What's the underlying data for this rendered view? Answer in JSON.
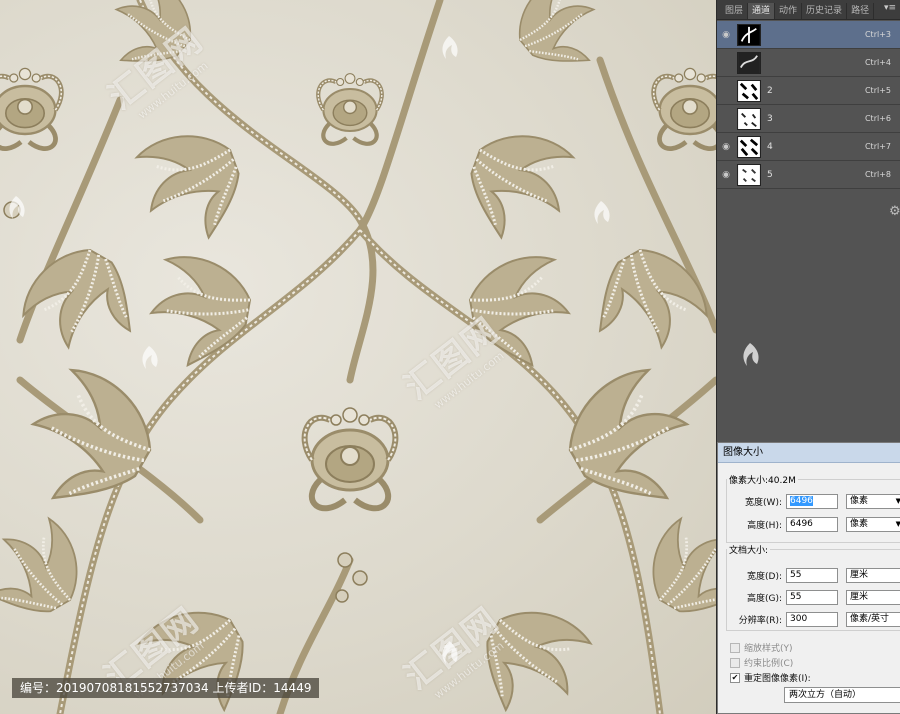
{
  "caption": "编号：20190708181552737034 上传者ID：14449",
  "watermark": {
    "text": "汇图网",
    "sub": "www.huitu.com"
  },
  "panel": {
    "tabs": [
      {
        "label": "图层",
        "active": false
      },
      {
        "label": "通道",
        "active": true
      },
      {
        "label": "动作",
        "active": false
      },
      {
        "label": "历史记录",
        "active": false
      },
      {
        "label": "路径",
        "active": false
      }
    ],
    "menu_icon": "panel-menu-icon",
    "channels": [
      {
        "name": "",
        "shortcut": "Ctrl+3",
        "selected": true
      },
      {
        "name": "",
        "shortcut": "Ctrl+4",
        "selected": false
      },
      {
        "name": "2",
        "shortcut": "Ctrl+5",
        "selected": false
      },
      {
        "name": "3",
        "shortcut": "Ctrl+6",
        "selected": false
      },
      {
        "name": "4",
        "shortcut": "Ctrl+7",
        "selected": false
      },
      {
        "name": "5",
        "shortcut": "Ctrl+8",
        "selected": false
      }
    ]
  },
  "dialog": {
    "title": "图像大小",
    "pixel_group": "像素大小:40.2M",
    "pixel_width_label": "宽度(W):",
    "pixel_width": "6496",
    "pixel_width_unit": "像素",
    "pixel_height_label": "高度(H):",
    "pixel_height": "6496",
    "pixel_height_unit": "像素",
    "doc_group": "文档大小:",
    "doc_width_label": "宽度(D):",
    "doc_width": "55",
    "doc_width_unit": "厘米",
    "doc_height_label": "高度(G):",
    "doc_height": "55",
    "doc_height_unit": "厘米",
    "resolution_label": "分辨率(R):",
    "resolution": "300",
    "resolution_unit": "像素/英寸",
    "scale_styles": "缩放样式(Y)",
    "constrain": "约束比例(C)",
    "resample": "重定图像像素(I):",
    "resample_method": "两次立方（自动）"
  },
  "colors": {
    "panel_bg": "#535353",
    "selected_row": "#5d6f8c",
    "damask_dark": "#a89a78",
    "damask_light": "#ece8dc"
  }
}
